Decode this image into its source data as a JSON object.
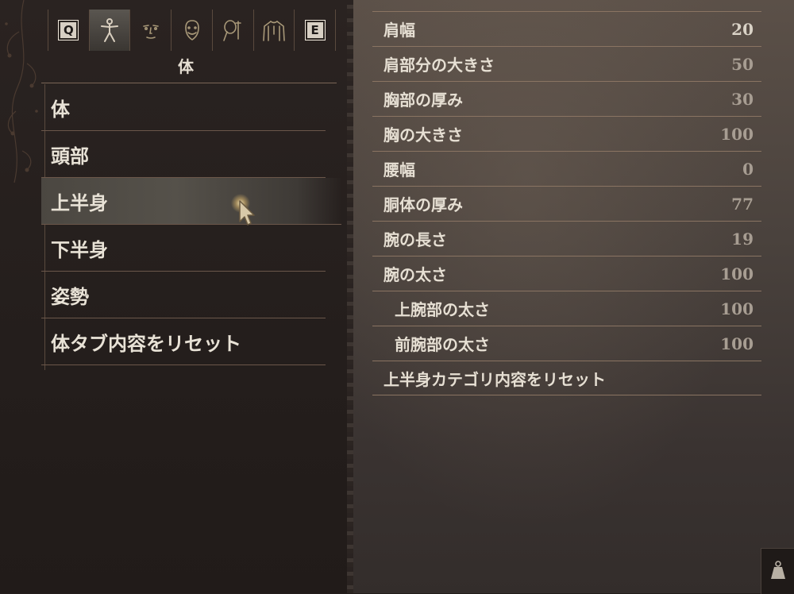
{
  "tabs": {
    "left_key": "Q",
    "right_key": "E",
    "icons": [
      "body-figure-icon",
      "face-icon",
      "head-beard-icon",
      "hair-icon",
      "torso-icon"
    ],
    "active_index": 0
  },
  "panel": {
    "title": "体",
    "categories": [
      {
        "label": "体"
      },
      {
        "label": "頭部"
      },
      {
        "label": "上半身"
      },
      {
        "label": "下半身"
      },
      {
        "label": "姿勢"
      },
      {
        "label": "体タブ内容をリセット"
      }
    ],
    "selected_category": "上半身"
  },
  "params": {
    "rows": [
      {
        "label": "肩幅",
        "value": "20"
      },
      {
        "label": "肩部分の大きさ",
        "value": "50"
      },
      {
        "label": "胸部の厚み",
        "value": "30"
      },
      {
        "label": "胸の大きさ",
        "value": "100"
      },
      {
        "label": "腰幅",
        "value": "0"
      },
      {
        "label": "胴体の厚み",
        "value": "77"
      },
      {
        "label": "腕の長さ",
        "value": "19"
      },
      {
        "label": "腕の太さ",
        "value": "100"
      },
      {
        "label": "上腕部の太さ",
        "value": "100"
      },
      {
        "label": "前腕部の太さ",
        "value": "100"
      },
      {
        "label": "上半身カテゴリ内容をリセット",
        "value": ""
      }
    ]
  },
  "colors": {
    "accent_line": "#8a7462",
    "selected_bg": "#55514a"
  }
}
